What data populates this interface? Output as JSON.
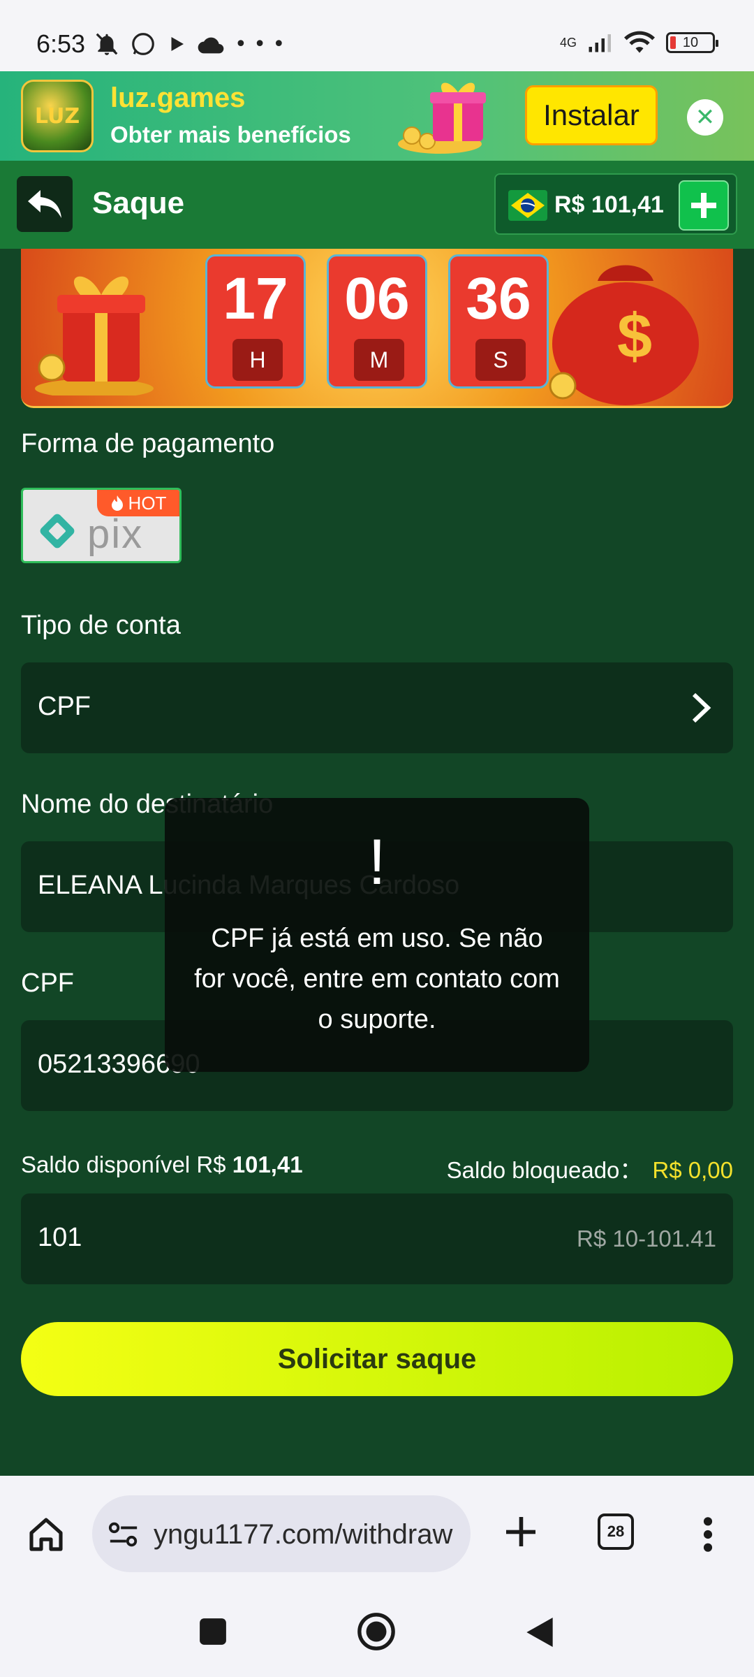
{
  "status_bar": {
    "time": "6:53",
    "network": "4G",
    "battery": "10"
  },
  "ad_banner": {
    "app_name": "luz.games",
    "tagline": "Obter mais benefícios",
    "install_label": "Instalar",
    "logo_text": "LUZ"
  },
  "header": {
    "title": "Saque",
    "balance": "R$ 101,41"
  },
  "countdown": {
    "hours": "17",
    "hours_unit": "H",
    "minutes": "06",
    "minutes_unit": "M",
    "seconds": "36",
    "seconds_unit": "S"
  },
  "form": {
    "payment_label": "Forma de pagamento",
    "payment_method": "pix",
    "hot_badge": "HOT",
    "account_type_label": "Tipo de conta",
    "account_type_value": "CPF",
    "recipient_label": "Nome do destinatário",
    "recipient_value": "ELEANA Lucinda Marques Cardoso",
    "cpf_label": "CPF",
    "cpf_value": "05213396690",
    "available_label": "Saldo disponível R$",
    "available_value": "101,41",
    "blocked_label": "Saldo bloqueado：",
    "blocked_value": "R$ 0,00",
    "amount_value": "101",
    "amount_hint": "R$ 10-101.41",
    "submit_label": "Solicitar saque"
  },
  "toast": {
    "icon": "!",
    "message": "CPF já está em uso. Se não for você, entre em contato com o suporte."
  },
  "browser": {
    "url": "yngu1177.com/withdraw",
    "tab_count": "28"
  },
  "colors": {
    "page_bg": "#124626",
    "header_bg": "#1a7a36",
    "accent_yellow": "#f4ff14",
    "blocked_value": "#f4e12c"
  }
}
